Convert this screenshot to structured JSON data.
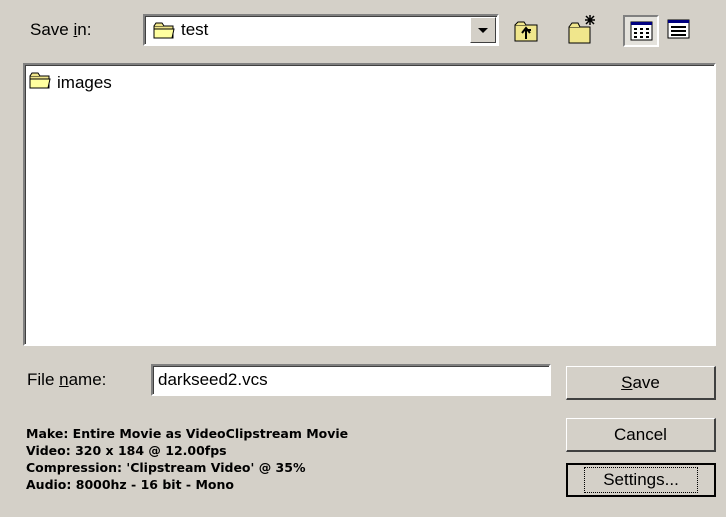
{
  "dialog": {
    "save_in_label": "Save in:",
    "save_in_value": "test",
    "file_list": [
      {
        "name": "images",
        "icon": "folder-icon"
      }
    ],
    "file_name_label": "File name:",
    "file_name_value": "darkseed2.vcs",
    "buttons": {
      "save": "Save",
      "cancel": "Cancel",
      "settings": "Settings..."
    },
    "info_lines": [
      "Make: Entire Movie as VideoClipstream Movie",
      "Video: 320 x 184 @ 12.00fps",
      "Compression: 'Clipstream Video' @ 35%",
      "Audio: 8000hz - 16 bit - Mono"
    ],
    "toolbar": [
      "up-one-level-icon",
      "create-new-folder-icon",
      "list-view-icon",
      "details-view-icon"
    ],
    "colors": {
      "face": "#d4d0c8",
      "folder": "#f0e68c"
    }
  }
}
